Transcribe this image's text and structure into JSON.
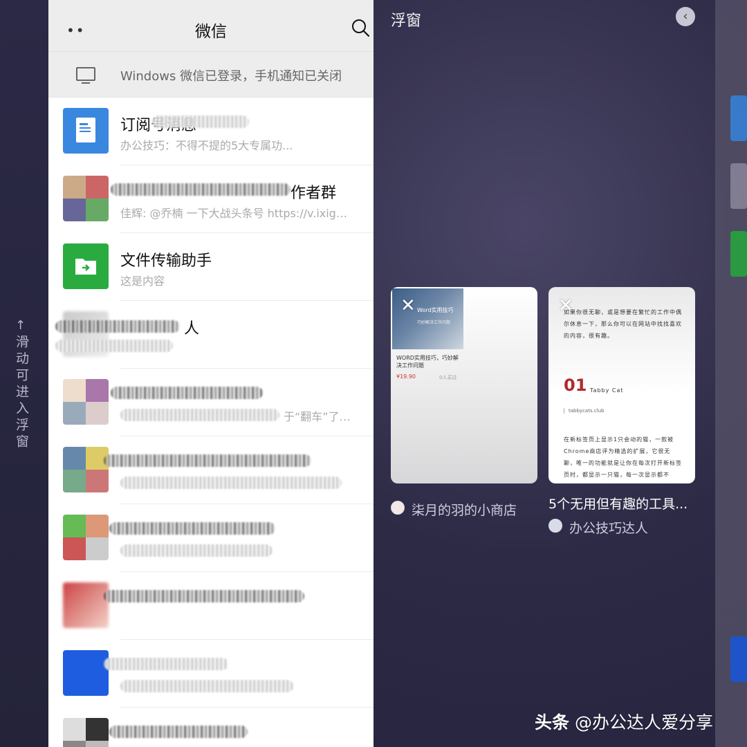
{
  "side_hint": {
    "text": "滑动可进入浮窗",
    "arrow": "↑"
  },
  "wechat": {
    "title": "微信",
    "menu_dots": "••",
    "notice": "Windows 微信已登录，手机通知已关闭",
    "chats": [
      {
        "name": "订阅号消息",
        "message": "办公技巧：不得不提的5大专属功...",
        "avatar": "doc-icon",
        "color": "#3a87e0"
      },
      {
        "name": "作者群",
        "message": "佳辉: @乔楠 一下大战头条号 https://v.ixigu...",
        "avatar": "group-grid"
      },
      {
        "name": "文件传输助手",
        "message": "这是内容",
        "avatar": "file-transfer-icon",
        "color": "#2aab3f"
      },
      {
        "name": "人",
        "message": "",
        "avatar": "blurred"
      },
      {
        "name": "",
        "message": "于“翻车”了。...",
        "avatar": "group-grid"
      },
      {
        "name": "",
        "message": "",
        "avatar": "group-grid"
      },
      {
        "name": "",
        "message": "",
        "avatar": "group-grid"
      },
      {
        "name": "",
        "message": "",
        "avatar": "blurred"
      },
      {
        "name": "",
        "message": "",
        "avatar": "blurred-blue"
      },
      {
        "name": "",
        "message": "",
        "avatar": "group-grid"
      }
    ]
  },
  "float": {
    "title": "浮窗",
    "collapse_icon": "‹",
    "cards": [
      {
        "close": "✕",
        "product_image_title": "Word实用技巧",
        "product_image_sub": "巧妙解决工作问题",
        "desc": "WORD实用技巧，巧妙解决工作问题",
        "price": "¥19.90",
        "sold": "0人买过",
        "source": "柒月的羽的小商店"
      },
      {
        "close": "✕",
        "para1": "如果你很无聊，或是想要在繁忙的工作中偶尔休息一下，那么你可以在网站中找找喜欢的内容，很有趣。",
        "number": "01",
        "category": "Tabby Cat",
        "url": "tabbycats.club",
        "para2": "在新标签页上显示1只会动的猫，一款被Chrome商店评为精选的扩展，它很无聊，唯一的功能就是让你在每次打开新标签页时，都显示一只猫，每一次显示都不",
        "title": "5个无用但有趣的工具...",
        "source": "办公技巧达人"
      }
    ]
  },
  "watermark": {
    "brand": "头条",
    "handle": "@办公达人爱分享"
  }
}
